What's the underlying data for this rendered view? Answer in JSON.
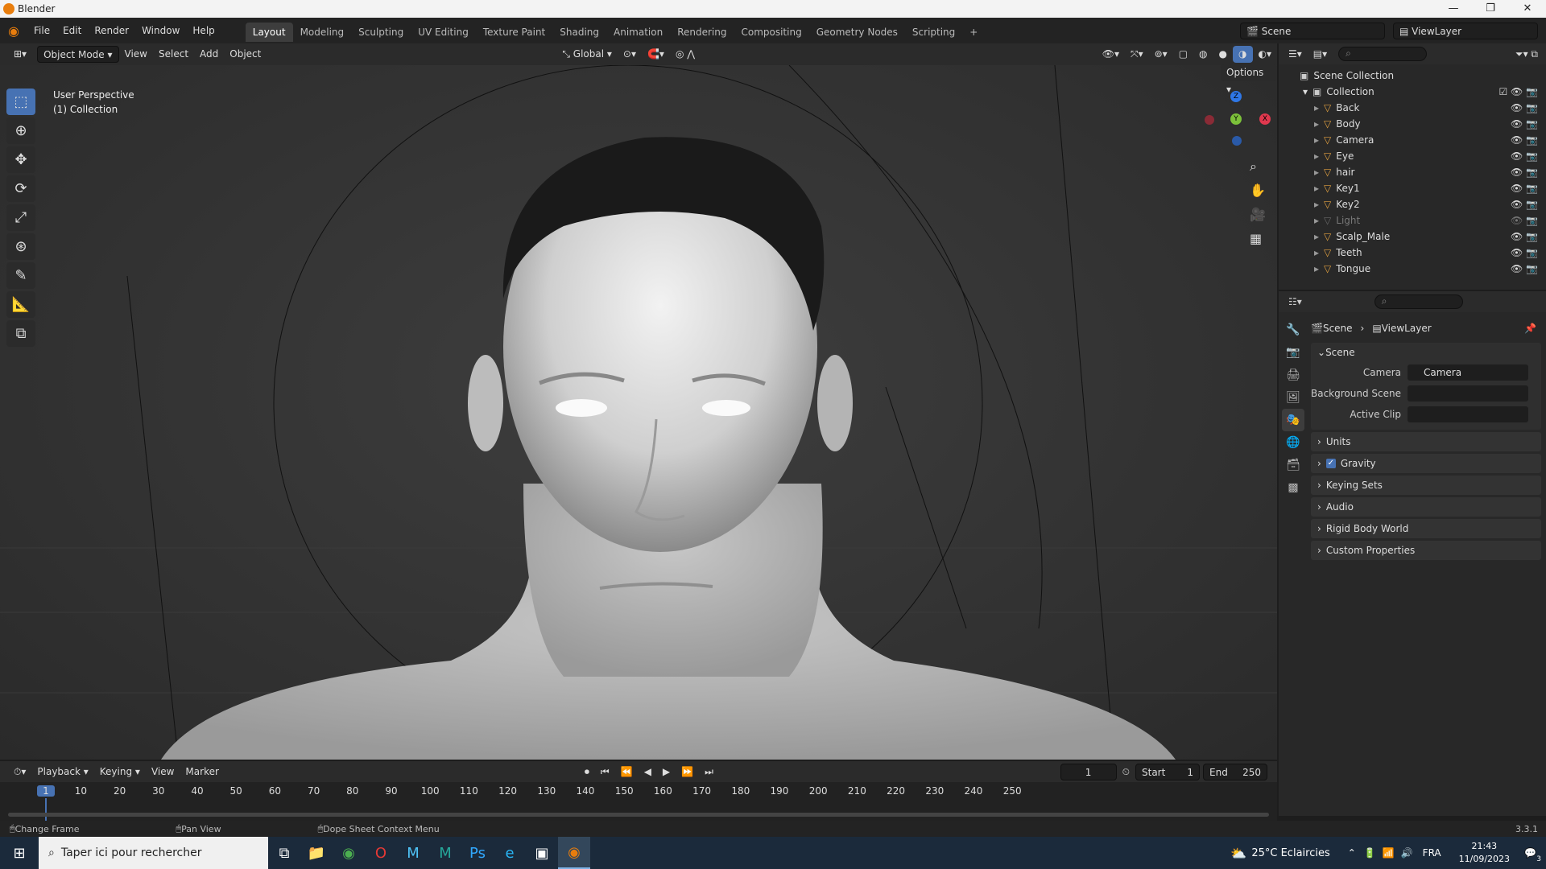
{
  "window": {
    "title": "Blender",
    "controls": [
      "—",
      "❐",
      "✕"
    ]
  },
  "menubar": {
    "menus": [
      "File",
      "Edit",
      "Render",
      "Window",
      "Help"
    ],
    "workspaces": [
      "Layout",
      "Modeling",
      "Sculpting",
      "UV Editing",
      "Texture Paint",
      "Shading",
      "Animation",
      "Rendering",
      "Compositing",
      "Geometry Nodes",
      "Scripting"
    ],
    "active_workspace": "Layout",
    "add_tab": "+",
    "scene": "Scene",
    "view_layer": "ViewLayer"
  },
  "viewport_header": {
    "mode": "Object Mode",
    "menus": [
      "View",
      "Select",
      "Add",
      "Object"
    ],
    "orientation": "Global",
    "options": "Options"
  },
  "viewport": {
    "perspective": "User Perspective",
    "collection": "(1) Collection",
    "gizmo": {
      "z": "Z",
      "x": "X",
      "y": "Y"
    }
  },
  "outliner": {
    "root": "Scene Collection",
    "collection": "Collection",
    "items": [
      {
        "name": "Back"
      },
      {
        "name": "Body"
      },
      {
        "name": "Camera"
      },
      {
        "name": "Eye"
      },
      {
        "name": "hair"
      },
      {
        "name": "Key1"
      },
      {
        "name": "Key2"
      },
      {
        "name": "Light"
      },
      {
        "name": "Scalp_Male"
      },
      {
        "name": "Teeth"
      },
      {
        "name": "Tongue"
      }
    ]
  },
  "properties": {
    "breadcrumb": {
      "scene": "Scene",
      "sep": "›",
      "view_layer": "ViewLayer"
    },
    "panel_title": "Scene",
    "fields": {
      "camera_label": "Camera",
      "camera_value": "Camera",
      "background_label": "Background Scene",
      "clip_label": "Active Clip"
    },
    "sections": [
      "Units",
      "Gravity",
      "Keying Sets",
      "Audio",
      "Rigid Body World",
      "Custom Properties"
    ],
    "gravity_checked": true
  },
  "timeline": {
    "menus": [
      "Playback",
      "Keying",
      "View",
      "Marker"
    ],
    "current_frame": "1",
    "start_label": "Start",
    "start": "1",
    "end_label": "End",
    "end": "250",
    "ticks": [
      "1",
      "10",
      "20",
      "30",
      "40",
      "50",
      "60",
      "70",
      "80",
      "90",
      "100",
      "110",
      "120",
      "130",
      "140",
      "150",
      "160",
      "170",
      "180",
      "190",
      "200",
      "210",
      "220",
      "230",
      "240",
      "250"
    ]
  },
  "statusbar": {
    "hints": [
      "Change Frame",
      "Pan View",
      "Dope Sheet Context Menu"
    ],
    "version": "3.3.1"
  },
  "taskbar": {
    "search_placeholder": "Taper ici pour rechercher",
    "weather": "25°C Eclaircies",
    "lang": "FRA",
    "time": "21:43",
    "date": "11/09/2023",
    "notif_count": "3"
  },
  "colors": {
    "accent": "#4772b3",
    "orange": "#e87d0d",
    "eye": "#ffffff"
  }
}
